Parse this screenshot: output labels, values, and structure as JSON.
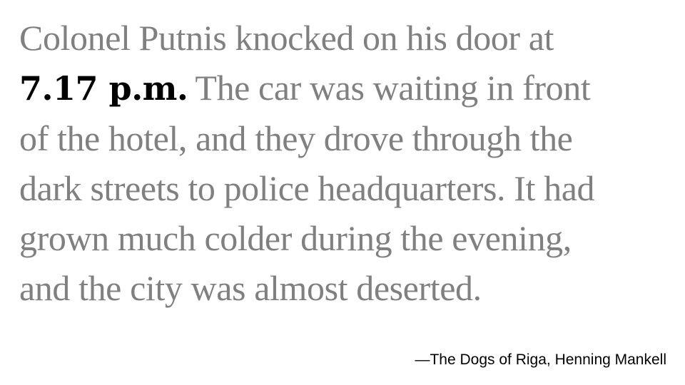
{
  "quote": {
    "line1": "Colonel Putnis knocked on his door at",
    "time": "7.17 p.m.",
    "line2_rest": "The car was waiting in front",
    "line3": "of the hotel, and they drove through the",
    "line4": "dark streets to police headquarters. It had",
    "line5": "grown much colder during the evening,",
    "line6": "and the city was almost deserted."
  },
  "attribution": "—The Dogs of Riga, Henning Mankell",
  "colors": {
    "quote_text": "#808080",
    "time_text": "#000000",
    "attribution_text": "#000000",
    "background": "#ffffff"
  }
}
